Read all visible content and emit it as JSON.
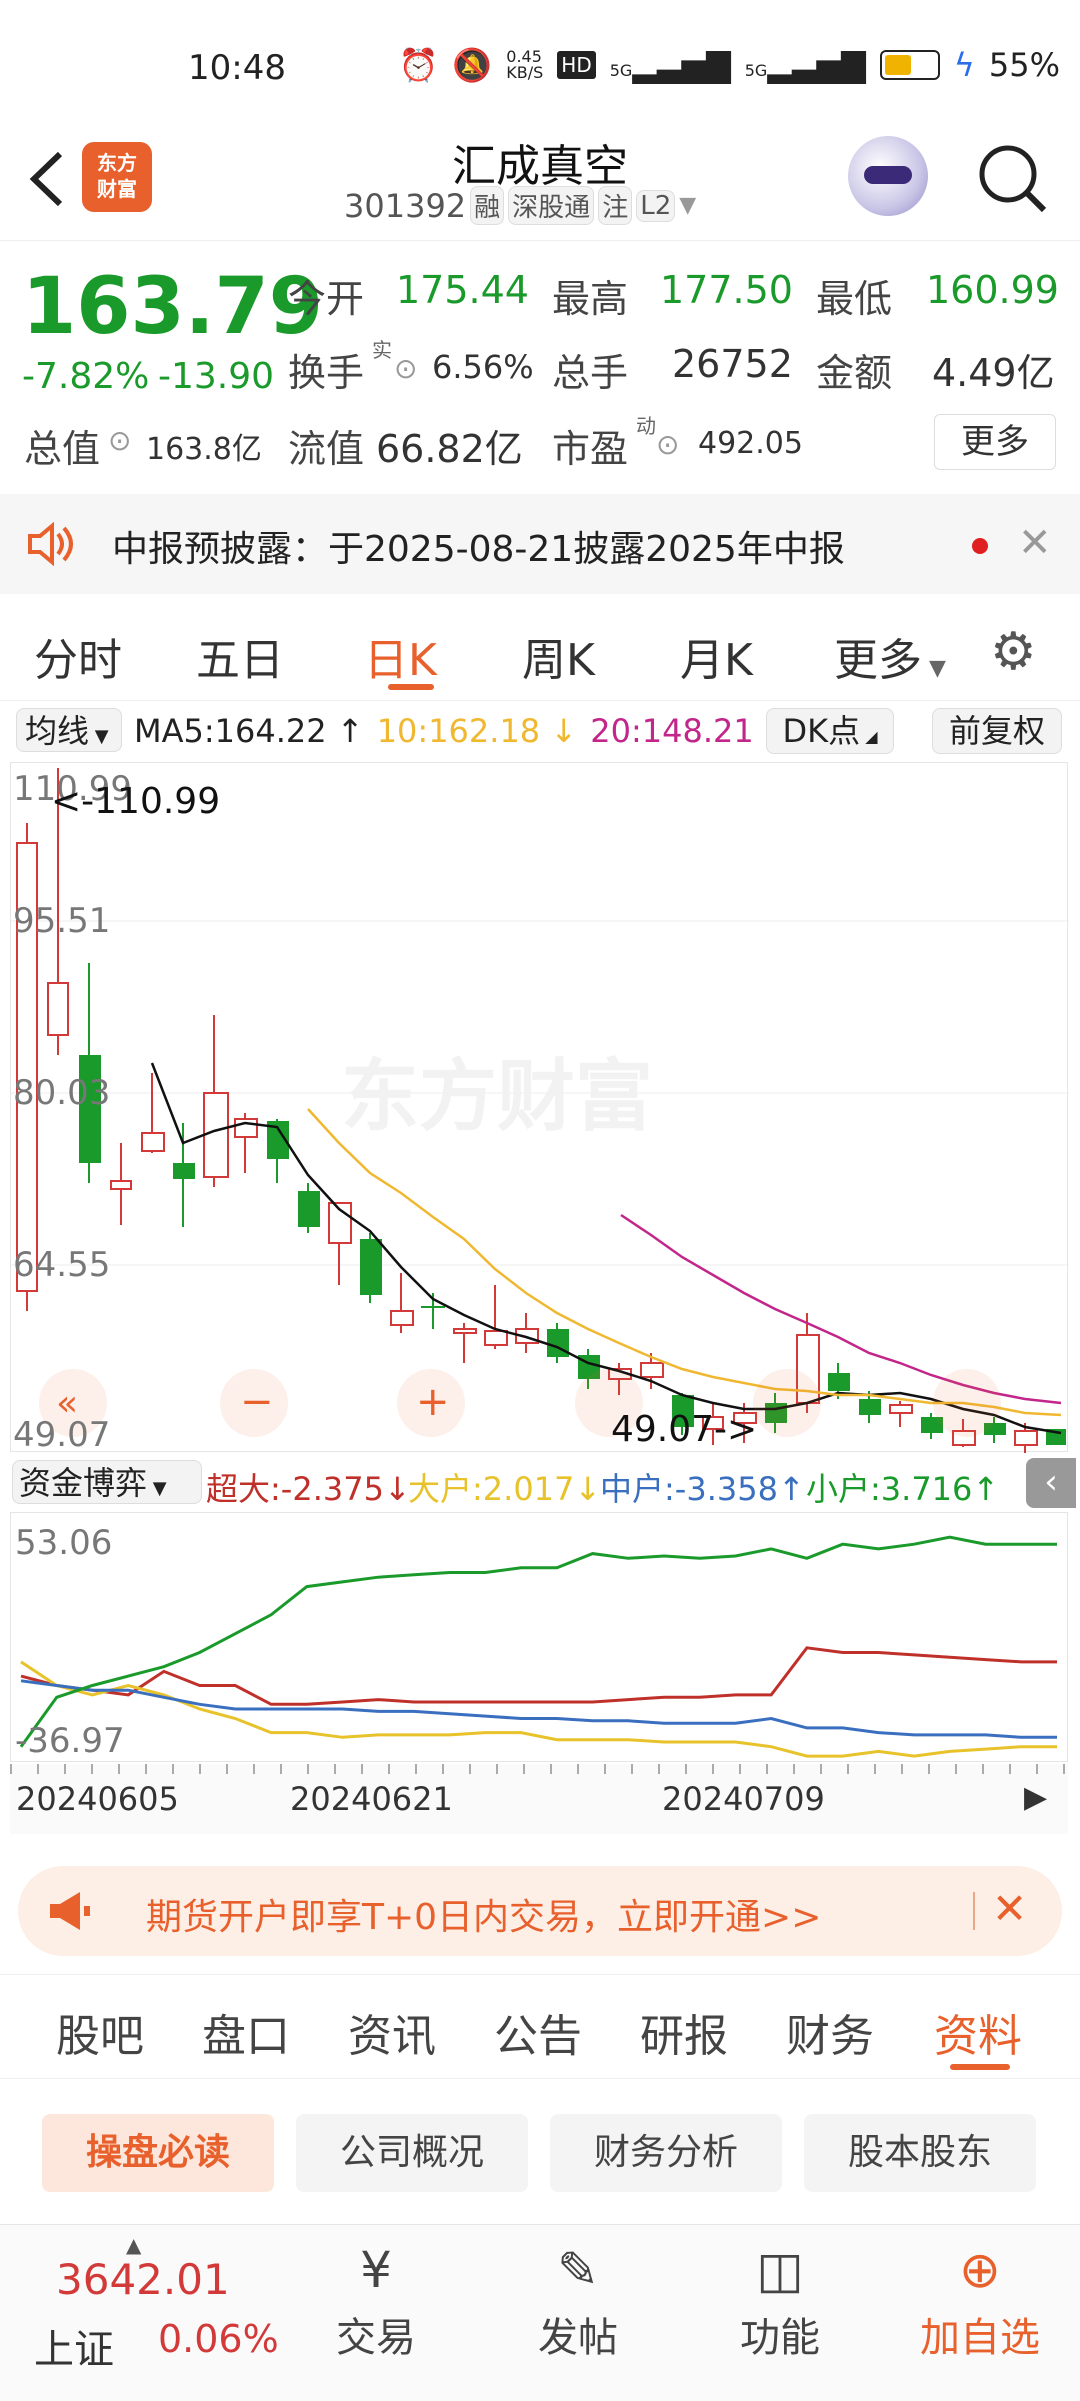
{
  "status_bar": {
    "time": "10:48",
    "net_speed": "0.45\nKB/S",
    "hd": "HD",
    "signal1": "5G",
    "signal2": "5G",
    "battery": "55%"
  },
  "header": {
    "back_icon": "chevron-left-icon",
    "logo_text": "东方\n财富",
    "title": "汇成真空",
    "code": "301392",
    "badges": [
      "融",
      "深股通",
      "注",
      "L2"
    ],
    "search_icon": "search-icon"
  },
  "quote": {
    "price": "163.79",
    "change_pct": "-7.82%",
    "change_amt": "-13.90",
    "open_label": "今开",
    "open": "175.44",
    "high_label": "最高",
    "high": "177.50",
    "low_label": "最低",
    "low": "160.99",
    "turnover_label": "换手",
    "turnover_sup": "实",
    "turnover": "6.56%",
    "volume_label": "总手",
    "volume": "26752",
    "amount_label": "金额",
    "amount": "4.49亿",
    "mcap_label": "总值",
    "mcap": "163.8亿",
    "float_label": "流值",
    "float": "66.82亿",
    "pe_label": "市盈",
    "pe_sup": "动",
    "pe": "492.05",
    "more_button": "更多"
  },
  "notice": {
    "text": "中报预披露：于2025-08-21披露2025年中报"
  },
  "period_tabs": [
    "分时",
    "五日",
    "日K",
    "周K",
    "月K",
    "更多"
  ],
  "active_period": "日K",
  "indicator_bar": {
    "ma_select": "均线",
    "ma5": "MA5:164.22",
    "ma10": "10:162.18",
    "ma20": "20:148.21",
    "dk_button": "DK点",
    "adjust_button": "前复权"
  },
  "kline": {
    "axis_labels": [
      "110.99",
      "95.51",
      "80.03",
      "64.55",
      "49.07"
    ],
    "max_label": "<-110.99",
    "min_label": "49.07->",
    "watermark": "东方财富"
  },
  "fund_bar": {
    "select": "资金博弈",
    "super": "超大:-2.375",
    "big": "大户:2.017",
    "mid": "中户:-3.358",
    "small": "小户:3.716"
  },
  "fund_chart": {
    "top": "53.06",
    "bottom": "-36.97"
  },
  "dates": [
    "20240605",
    "20240621",
    "20240709"
  ],
  "colors": {
    "up": "#d23a3a",
    "down": "#1a9a2a",
    "accent": "#e8602c",
    "ma5": "#111111",
    "ma10": "#f0b830",
    "ma20": "#c2268a",
    "mid": "#3a6fbf",
    "small": "#1a9a2a",
    "big": "#e8c22a",
    "super": "#c0302a"
  },
  "chart_data": {
    "type": "line",
    "series": [
      {
        "name": "超大",
        "values": [
          -6,
          -10,
          -12,
          -14,
          -4,
          -10,
          -10,
          -18,
          -18,
          -17,
          -16,
          -17,
          -17,
          -17,
          -17,
          -17,
          -17,
          -16,
          -15,
          -15,
          -14,
          -14,
          6,
          4,
          4,
          3,
          2,
          1,
          0,
          0
        ]
      },
      {
        "name": "大户",
        "values": [
          0,
          -10,
          -14,
          -10,
          -14,
          -20,
          -24,
          -30,
          -30,
          -32,
          -31,
          -31,
          -31,
          -30,
          -30,
          -33,
          -33,
          -33,
          -34,
          -34,
          -34,
          -36,
          -40,
          -40,
          -38,
          -40,
          -38,
          -37,
          -36,
          -36
        ]
      },
      {
        "name": "中户",
        "values": [
          -8,
          -10,
          -12,
          -12,
          -15,
          -18,
          -20,
          -20,
          -20,
          -20,
          -21,
          -21,
          -22,
          -23,
          -24,
          -24,
          -25,
          -25,
          -26,
          -26,
          -26,
          -24,
          -28,
          -28,
          -30,
          -31,
          -31,
          -31,
          -32,
          -32
        ]
      },
      {
        "name": "小户",
        "values": [
          -36,
          -15,
          -10,
          -6,
          -2,
          4,
          12,
          20,
          32,
          34,
          36,
          37,
          38,
          38,
          40,
          40,
          46,
          44,
          45,
          44,
          45,
          48,
          44,
          50,
          48,
          50,
          53,
          50,
          50,
          50
        ]
      }
    ]
  }
}
